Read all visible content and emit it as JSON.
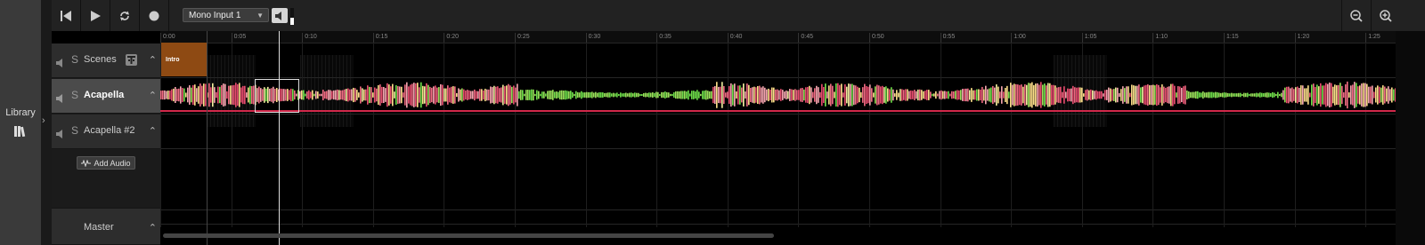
{
  "library": {
    "label": "Library",
    "icon": "library-books-icon",
    "toggle_icon": "chevron-right-icon"
  },
  "toolbar": {
    "skip_back_icon": "skip-to-start-icon",
    "play_icon": "play-icon",
    "loop_icon": "loop-icon",
    "record_icon": "record-icon",
    "input_select": {
      "value": "Mono Input 1"
    },
    "monitor_icon": "speaker-icon",
    "input_level": 0.4,
    "zoom_out_icon": "zoom-out-icon",
    "zoom_in_icon": "zoom-in-icon"
  },
  "ruler": {
    "ticks": [
      "0:00",
      "0:05",
      "0:10",
      "0:15",
      "0:20",
      "0:25",
      "0:30",
      "0:35",
      "0:40",
      "0:45",
      "0:50",
      "0:55",
      "1:00",
      "1:05",
      "1:10",
      "1:15",
      "1:20",
      "1:25"
    ]
  },
  "tracks": {
    "scenes": {
      "name": "Scenes",
      "solo": "S",
      "clip": {
        "label": "Intro",
        "color": "#8e4a13"
      }
    },
    "acapella": {
      "name": "Acapella",
      "solo": "S"
    },
    "acapella2": {
      "name": "Acapella #2",
      "solo": "S"
    },
    "master": {
      "name": "Master"
    }
  },
  "add_audio": {
    "label": "Add Audio"
  },
  "colors": {
    "waveform": [
      "#f06a82",
      "#f7a6b0",
      "#ffe08a",
      "#e84b6e",
      "#6fe04a",
      "#9be25a",
      "#f5f0a0"
    ],
    "region_base": "#d0284a"
  }
}
